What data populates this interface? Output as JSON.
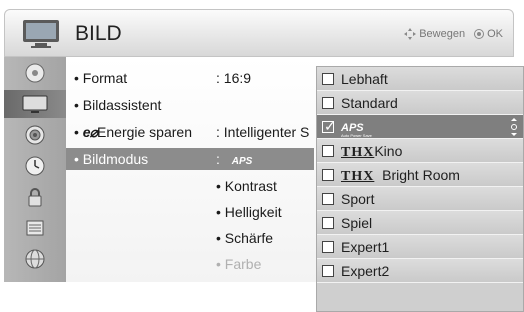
{
  "header": {
    "title": "BILD",
    "hint_move": "Bewegen",
    "hint_ok": "OK"
  },
  "sidebar": {
    "items": [
      {
        "icon": "satellite-dish-icon"
      },
      {
        "icon": "tv-picture-icon",
        "active": true
      },
      {
        "icon": "speaker-icon"
      },
      {
        "icon": "clock-icon"
      },
      {
        "icon": "lock-icon"
      },
      {
        "icon": "options-icon"
      },
      {
        "icon": "network-icon"
      }
    ]
  },
  "menu": {
    "format_label": "Format",
    "format_value": ": 16:9",
    "assistant_label": "Bildassistent",
    "energy_prefix": "e",
    "energy_label": "Energie sparen",
    "energy_value": ": Intelligenter S",
    "mode_label": "Bildmodus",
    "mode_value_colon": ":",
    "mode_value_logo": "APS",
    "sub_items": [
      "• Kontrast",
      "• Helligkeit",
      "• Schärfe",
      "• Farbe"
    ]
  },
  "dropdown": {
    "options": [
      "Lebhaft",
      "Standard",
      "APS",
      "Kino",
      "Bright Room",
      "Sport",
      "Spiel",
      "Expert1",
      "Expert2"
    ],
    "selected_index": 2,
    "thx_logo": "THX",
    "aps_subtext": "Auto Power Save"
  },
  "colors": {
    "selected_row": "#8c8c8c",
    "sidebar": "#ababab",
    "dropdown_bg": "#cfcfcf"
  }
}
